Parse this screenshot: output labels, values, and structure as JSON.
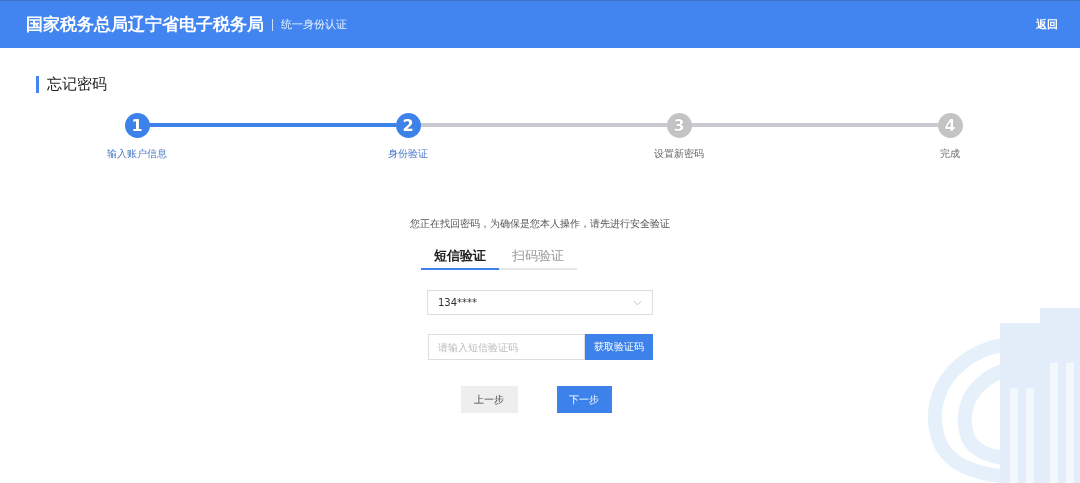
{
  "header": {
    "title": "国家税务总局辽宁省电子税务局",
    "subtitle": "统一身份认证",
    "back_link": "返回"
  },
  "page_title": "忘记密码",
  "steps": [
    {
      "number": "1",
      "label": "输入账户信息",
      "active": true
    },
    {
      "number": "2",
      "label": "身份验证",
      "active": true
    },
    {
      "number": "3",
      "label": "设置新密码",
      "active": false
    },
    {
      "number": "4",
      "label": "完成",
      "active": false
    }
  ],
  "message": "您正在找回密码，为确保是您本人操作，请先进行安全验证",
  "tabs": [
    {
      "label": "短信验证",
      "selected": true
    },
    {
      "label": "扫码验证",
      "selected": false
    }
  ],
  "phone_select": {
    "value": "134****"
  },
  "code_field": {
    "placeholder": "请输入短信验证码"
  },
  "get_code_button": "获取验证码",
  "buttons": [
    {
      "label": "上一步",
      "kind": "secondary"
    },
    {
      "label": "下一步",
      "kind": "primary"
    }
  ]
}
